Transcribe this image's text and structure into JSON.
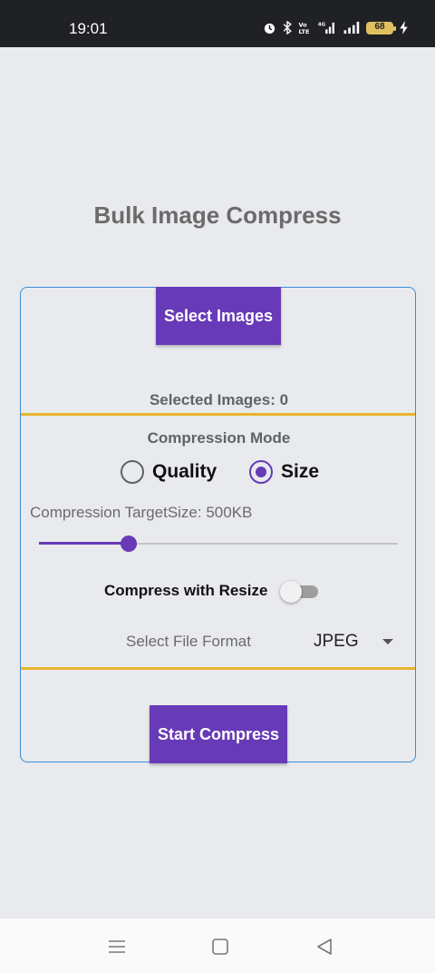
{
  "status_bar": {
    "time": "19:01",
    "battery": "68",
    "icons": [
      "alarm-icon",
      "bluetooth-icon",
      "volte-icon",
      "signal-4g-icon",
      "signal-icon",
      "battery-icon",
      "charging-icon"
    ]
  },
  "app": {
    "title": "Bulk Image Compress"
  },
  "card": {
    "select_button": "Select Images",
    "selected_count": "Selected Images: 0",
    "compression_mode_label": "Compression Mode",
    "modes": [
      {
        "label": "Quality",
        "selected": false
      },
      {
        "label": "Size",
        "selected": true
      }
    ],
    "target_label": "Compression TargetSize: 500KB",
    "slider_value_fraction": 0.25,
    "resize_label": "Compress with Resize",
    "resize_enabled": false,
    "file_format_label": "Select File Format",
    "file_format_value": "JPEG",
    "start_button": "Start Compress"
  },
  "colors": {
    "accent": "#673ab7",
    "divider": "#e6b52e",
    "card_border": "#3a8fd6",
    "background": "#e8eaed"
  },
  "nav_bar": {
    "icons": [
      "menu-icon",
      "home-icon",
      "back-icon"
    ]
  }
}
